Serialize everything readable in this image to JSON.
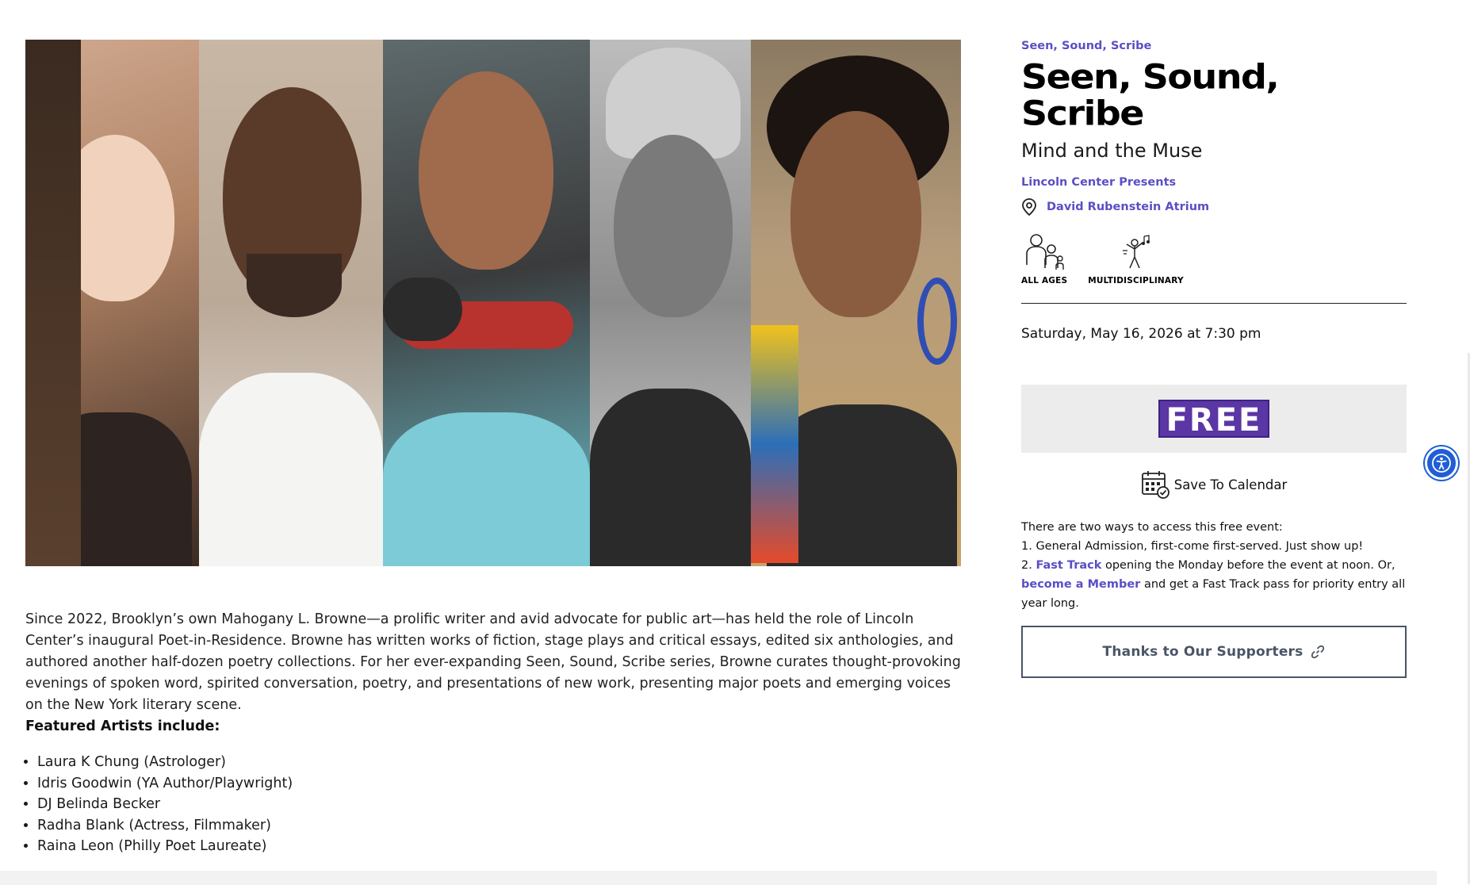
{
  "sidebar": {
    "series_link": "Seen, Sound, Scribe",
    "title": "Seen, Sound, Scribe",
    "subtitle": "Mind and the Muse",
    "presenter": "Lincoln Center Presents",
    "venue": "David Rubenstein Atrium",
    "tags": [
      {
        "icon": "all-ages-icon",
        "label": "ALL AGES"
      },
      {
        "icon": "multidisciplinary-icon",
        "label": "MULTIDISCIPLINARY"
      }
    ],
    "datetime": "Saturday, May 16, 2026 at 7:30 pm",
    "price": "FREE",
    "save_calendar": "Save To Calendar",
    "access_intro": "There are two ways to access this free event:",
    "access_line1": "1. General Admission, first-come first-served. Just show up!",
    "access_line2_prefix": "2. ",
    "fast_track_link": "Fast Track",
    "access_line2_suffix": " opening the Monday before the event at noon. Or,",
    "member_link": "become a Member",
    "access_line3_suffix": " and get a Fast Track pass for priority entry all year long.",
    "supporters_button": "Thanks to Our Supporters"
  },
  "main": {
    "description": "Since 2022, Brooklyn’s own Mahogany L. Browne—a prolific writer and avid advocate for public art—has held the role of Lincoln Center’s inaugural Poet-in-Residence. Browne has written works of fiction, stage plays and critical essays, edited six anthologies, and authored another half-dozen poetry collections. For her ever-expanding Seen, Sound, Scribe series, Browne curates thought-provoking evenings of spoken word, spirited conversation, poetry, and presentations of new work, presenting major poets and emerging voices on the New York literary scene.",
    "featured_heading": "Featured Artists include:",
    "artists": [
      "Laura K Chung (Astrologer)",
      "Idris Goodwin (YA Author/Playwright)",
      "DJ Belinda Becker",
      "Radha Blank (Actress, Filmmaker)",
      "Raina Leon (Philly Poet Laureate)"
    ]
  },
  "colors": {
    "link": "#5a4fc4",
    "badge": "#5b36a5",
    "accessibility": "#1f5ed6"
  }
}
